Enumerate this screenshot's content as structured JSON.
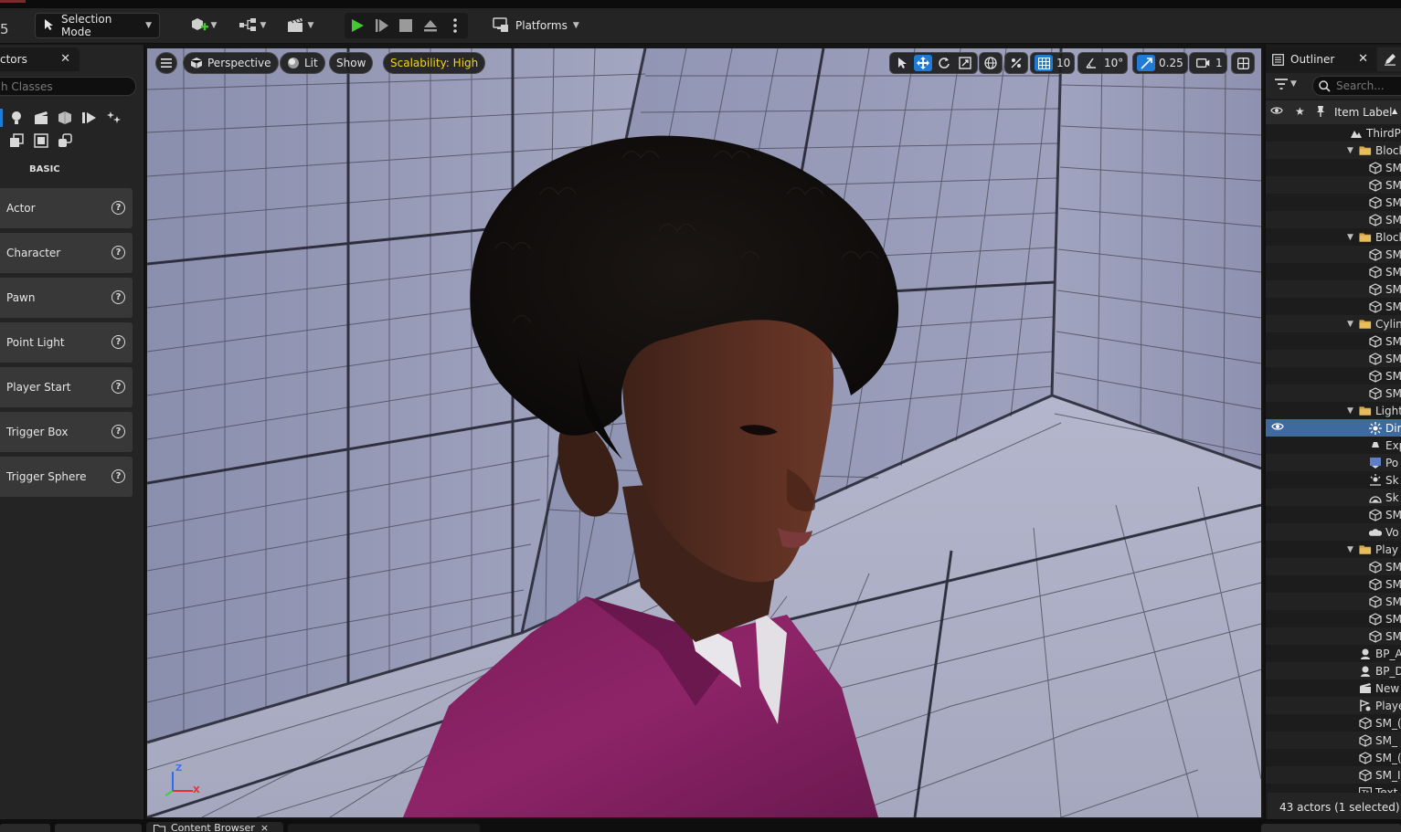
{
  "toolbar": {
    "number": "5",
    "mode_label": "Selection Mode",
    "platforms_label": "Platforms",
    "colors": {
      "play_green": "#41c92f",
      "accent_blue": "#1f7bd6"
    }
  },
  "left_panel": {
    "tab_title": "ctors",
    "search_placeholder": "h Classes",
    "category_label": "BASIC",
    "category_icons": [
      "recent-icon",
      "light-icon",
      "cinematic-icon",
      "shapes-icon",
      "visual-effects-icon",
      "volumes-icon",
      "geometry-icon",
      "all-classes-icon",
      "place-extra-icon"
    ],
    "items": [
      "Actor",
      "Character",
      "Pawn",
      "Point Light",
      "Player Start",
      "Trigger Box",
      "Trigger Sphere"
    ]
  },
  "viewport": {
    "perspective": "Perspective",
    "lit": "Lit",
    "show": "Show",
    "scalability": "Scalability: High",
    "grid_snap": "10",
    "rotation_snap": "10°",
    "scale_snap": "0.25",
    "camera_speed": "1",
    "axis": {
      "z": "Z",
      "x": "X"
    }
  },
  "outliner": {
    "tab_title": "Outliner",
    "search_placeholder": "Search...",
    "column_label": "Item Label",
    "sort_indicator": "▲",
    "rows": [
      {
        "depth": 0,
        "icon": "map-icon",
        "label": "ThirdP",
        "folder": false
      },
      {
        "depth": 1,
        "icon": "folder-icon",
        "label": "Block",
        "folder": true,
        "expanded": true
      },
      {
        "depth": 2,
        "icon": "mesh-icon",
        "label": "SM"
      },
      {
        "depth": 2,
        "icon": "mesh-icon",
        "label": "SM"
      },
      {
        "depth": 2,
        "icon": "mesh-icon",
        "label": "SM"
      },
      {
        "depth": 2,
        "icon": "mesh-icon",
        "label": "SM"
      },
      {
        "depth": 1,
        "icon": "folder-icon",
        "label": "Block",
        "folder": true,
        "expanded": true
      },
      {
        "depth": 2,
        "icon": "mesh-icon",
        "label": "SM"
      },
      {
        "depth": 2,
        "icon": "mesh-icon",
        "label": "SM"
      },
      {
        "depth": 2,
        "icon": "mesh-icon",
        "label": "SM"
      },
      {
        "depth": 2,
        "icon": "mesh-icon",
        "label": "SM"
      },
      {
        "depth": 1,
        "icon": "folder-icon",
        "label": "Cylin",
        "folder": true,
        "expanded": true
      },
      {
        "depth": 2,
        "icon": "mesh-icon",
        "label": "SM"
      },
      {
        "depth": 2,
        "icon": "mesh-icon",
        "label": "SM"
      },
      {
        "depth": 2,
        "icon": "mesh-icon",
        "label": "SM"
      },
      {
        "depth": 2,
        "icon": "mesh-icon",
        "label": "SM"
      },
      {
        "depth": 1,
        "icon": "folder-icon",
        "label": "Light",
        "folder": true,
        "expanded": true
      },
      {
        "depth": 2,
        "icon": "directional-light-icon",
        "label": "Dir",
        "selected": true
      },
      {
        "depth": 2,
        "icon": "exponential-fog-icon",
        "label": "Exp"
      },
      {
        "depth": 2,
        "icon": "post-process-icon",
        "label": "Po"
      },
      {
        "depth": 2,
        "icon": "sky-light-icon",
        "label": "Sk"
      },
      {
        "depth": 2,
        "icon": "sky-atmosphere-icon",
        "label": "Sk"
      },
      {
        "depth": 2,
        "icon": "mesh-icon",
        "label": "SM"
      },
      {
        "depth": 2,
        "icon": "volumetric-cloud-icon",
        "label": "Vo"
      },
      {
        "depth": 1,
        "icon": "folder-icon",
        "label": "Play",
        "folder": true,
        "expanded": true
      },
      {
        "depth": 2,
        "icon": "mesh-icon",
        "label": "SM"
      },
      {
        "depth": 2,
        "icon": "mesh-icon",
        "label": "SM"
      },
      {
        "depth": 2,
        "icon": "mesh-icon",
        "label": "SM"
      },
      {
        "depth": 2,
        "icon": "mesh-icon",
        "label": "SM"
      },
      {
        "depth": 2,
        "icon": "mesh-icon",
        "label": "SM"
      },
      {
        "depth": 1,
        "icon": "blueprint-icon",
        "label": "BP_A"
      },
      {
        "depth": 1,
        "icon": "blueprint-icon",
        "label": "BP_D"
      },
      {
        "depth": 1,
        "icon": "level-sequence-icon",
        "label": "New"
      },
      {
        "depth": 1,
        "icon": "player-start-icon",
        "label": "Playe"
      },
      {
        "depth": 1,
        "icon": "mesh-icon",
        "label": "SM_("
      },
      {
        "depth": 1,
        "icon": "mesh-icon",
        "label": "SM_"
      },
      {
        "depth": 1,
        "icon": "mesh-icon",
        "label": "SM_("
      },
      {
        "depth": 1,
        "icon": "mesh-icon",
        "label": "SM_I"
      },
      {
        "depth": 1,
        "icon": "text-render-icon",
        "label": "Text"
      }
    ],
    "footer": "43 actors (1 selected)"
  },
  "bottom": {
    "content_browser_tab": "Content Browser",
    "close": "×"
  }
}
